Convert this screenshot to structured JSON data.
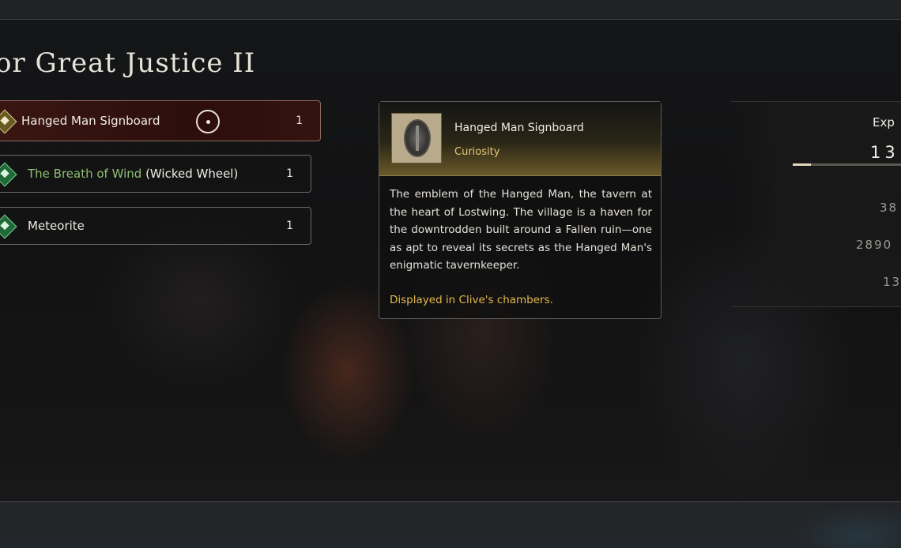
{
  "quest": {
    "title": "or Great Justice II"
  },
  "rewards": [
    {
      "label": "Hanged Man Signboard",
      "count": "1",
      "selected": true
    },
    {
      "label_green": "The Breath of Wind",
      "label_suffix": " (Wicked Wheel)",
      "count": "1"
    },
    {
      "label": "Meteorite",
      "count": "1"
    }
  ],
  "detail": {
    "name": "Hanged Man Signboard",
    "category": "Curiosity",
    "description": "The emblem of the Hanged Man, the tavern at the heart of Lostwing. The village is a haven for the downtrodden built around a Fallen ruin—one as apt to reveal its secrets as the Hanged Man's enigmatic tavernkeeper.",
    "note": "Displayed in Clive's chambers."
  },
  "stats": {
    "label": "Exp",
    "value": "13",
    "progress_fraction": 0.17,
    "row1": "38",
    "row2": "2890",
    "row3": "13"
  },
  "colors": {
    "accent_gold": "#e5c978",
    "note_gold": "#e5b94a",
    "selected_bg": "#3a1612",
    "icon_green": "#1f6a38"
  },
  "icons": [
    "item-diamond-icon",
    "select-cursor-icon",
    "signboard-emblem-icon"
  ]
}
